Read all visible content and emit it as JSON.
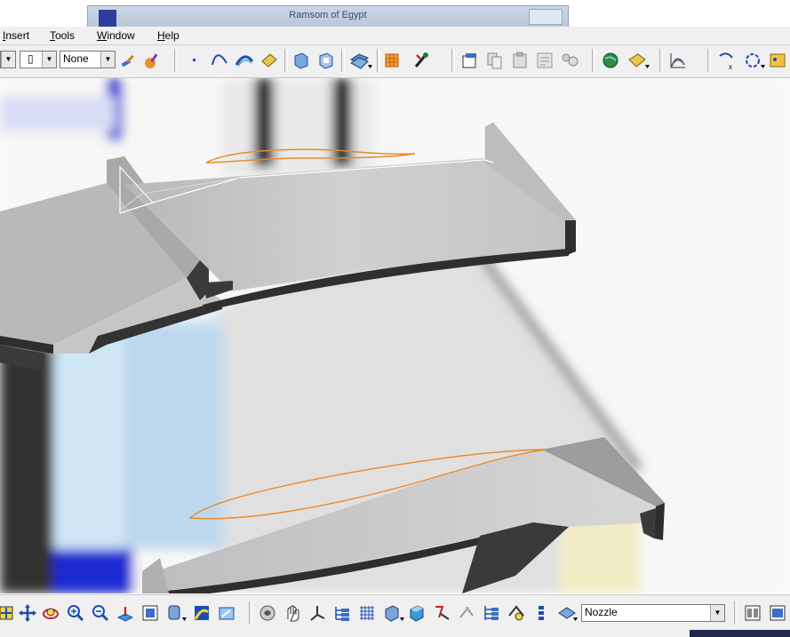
{
  "background_window": {
    "title": "Ramsom of Egypt"
  },
  "menu": [
    {
      "label": "Insert",
      "accel": "I",
      "rest": "nsert"
    },
    {
      "label": "Tools",
      "accel": "T",
      "rest": "ools"
    },
    {
      "label": "Window",
      "accel": "W",
      "rest": "indow"
    },
    {
      "label": "Help",
      "accel": "H",
      "rest": "elp"
    }
  ],
  "toolbar": {
    "linetype_combo": {
      "value": "None"
    }
  },
  "bottom_toolbar": {
    "layer_combo": {
      "value": "Nozzle"
    }
  },
  "colors": {
    "toolbar_bg": "#f0f0f0",
    "surface_light": "#cfcfcf",
    "surface_dark": "#3a3a3a",
    "curve": "#e8892a",
    "accent_blue": "#1a2bd1"
  },
  "icons": {
    "top": [
      "combo-arrow-icon",
      "layer-combo-icon",
      "paint-brush-icon",
      "magic-wand-icon",
      "point-icon",
      "spline-icon",
      "arc-icon",
      "sketch-icon",
      "extrude-icon",
      "pocket-icon",
      "surface-icon",
      "grid-icon",
      "snap-icon",
      "properties-icon",
      "copy-icon",
      "paste-icon",
      "rename-icon",
      "macro-icon",
      "globe-icon",
      "render-icon",
      "curve-analysis-icon",
      "reframe-icon",
      "rotate-view-icon",
      "palette-icon"
    ],
    "bottom": [
      "fit-all-icon",
      "pan-icon",
      "rotate-icon",
      "zoom-in-icon",
      "zoom-out-icon",
      "normal-view-icon",
      "multi-view-icon",
      "views-icon",
      "render-style-icon",
      "hide-show-icon",
      "swap-visible-icon",
      "compass-icon",
      "axis-icon",
      "tree-icon",
      "grid-icon",
      "box-icon",
      "cube-icon",
      "measure-icon",
      "measure2-icon",
      "hierarchy-icon",
      "snap-icon",
      "filter-icon",
      "layer-icon",
      "window-tile-icon",
      "window-cascade-icon"
    ]
  }
}
